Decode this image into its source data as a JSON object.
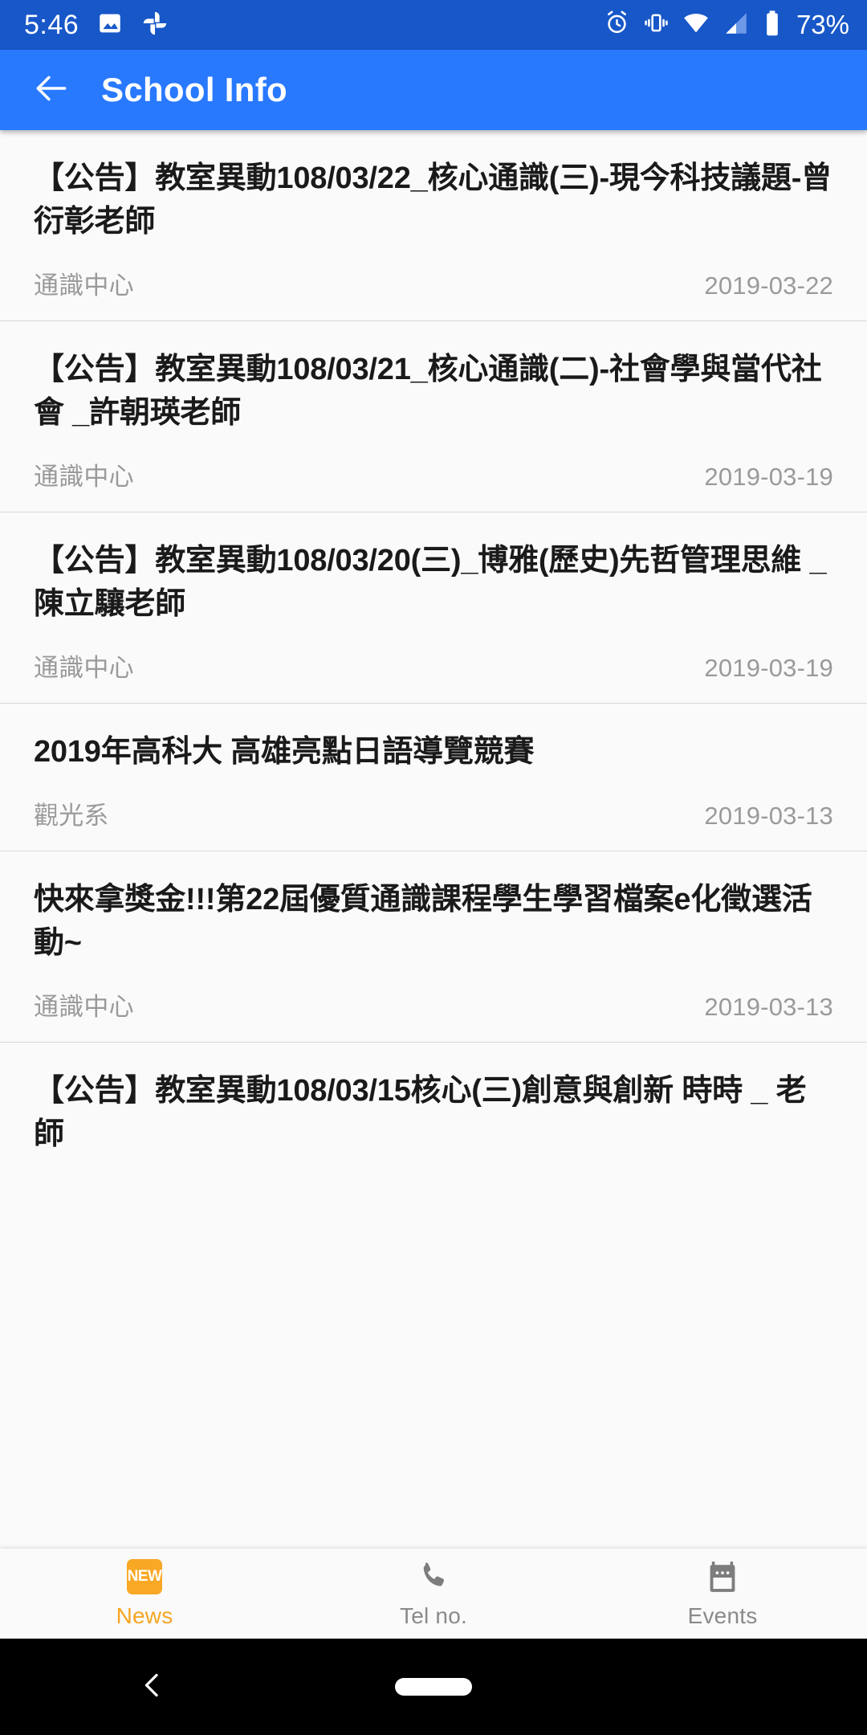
{
  "status_bar": {
    "time": "5:46",
    "battery_text": "73%",
    "icons": [
      "photo-icon",
      "google-photos-icon",
      "alarm-icon",
      "vibrate-icon",
      "wifi-icon",
      "cellular-signal-icon",
      "battery-icon"
    ],
    "background_color": "#1757c8"
  },
  "app_bar": {
    "title": "School Info",
    "back_label": "back-arrow",
    "background_color": "#2979ff"
  },
  "news_items": [
    {
      "title": "【公告】教室異動108/03/22_核心通識(三)-現今科技議題-曾衍彰老師",
      "source": "通識中心",
      "date": "2019-03-22"
    },
    {
      "title": "【公告】教室異動108/03/21_核心通識(二)-社會學與當代社會 _許朝瑛老師",
      "source": "通識中心",
      "date": "2019-03-19"
    },
    {
      "title": "【公告】教室異動108/03/20(三)_博雅(歷史)先哲管理思維 _陳立驤老師",
      "source": "通識中心",
      "date": "2019-03-19"
    },
    {
      "title": "2019年高科大 高雄亮點日語導覽競賽",
      "source": "觀光系",
      "date": "2019-03-13"
    },
    {
      "title": "快來拿獎金!!!第22屆優質通識課程學生學習檔案e化徵選活動~",
      "source": "通識中心",
      "date": "2019-03-13"
    },
    {
      "title": "【公告】教室異動108/03/15核心(三)創意與創新 時時 _ 老師",
      "source": "",
      "date": ""
    }
  ],
  "tab_bar": {
    "active_color": "#f5a623",
    "inactive_color": "#8a8a8a",
    "tabs": [
      {
        "label": "News",
        "icon": "new-badge-icon",
        "active": true
      },
      {
        "label": "Tel no.",
        "icon": "phone-icon",
        "active": false
      },
      {
        "label": "Events",
        "icon": "calendar-icon",
        "active": false
      }
    ]
  },
  "nav_bar": {
    "back": "back-chevron-icon",
    "home": "home-pill-icon"
  }
}
